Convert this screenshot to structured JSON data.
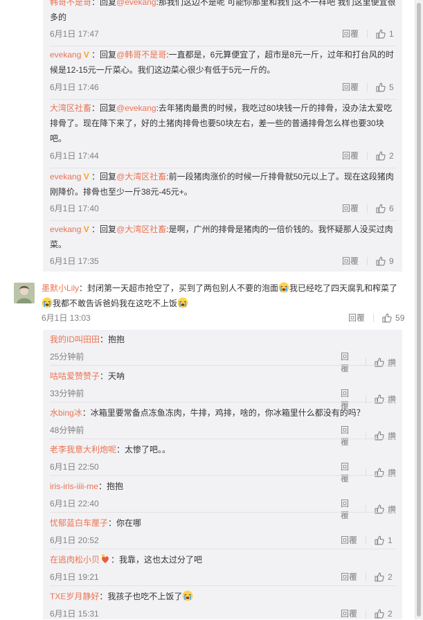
{
  "replies_top": [
    {
      "user": "韩哥不是哥",
      "verified": false,
      "reply_prefix": "：回复",
      "reply_to": "@evekang",
      "text": ":那我们这边不是呢  可能你那里和我们这不一样吧  我们这里便宜很多的",
      "time": "6月1日 17:47",
      "reply_label": "回覆",
      "likes": "1"
    },
    {
      "user": "evekang",
      "verified": true,
      "reply_prefix": "：回复",
      "reply_to": "@韩哥不是哥",
      "text": ":一直都是，6元算便宜了，超市是8元一斤，过年和打台风的时候是12-15元一斤菜心。我们这边菜心很少有低于5元一斤的。",
      "time": "6月1日 17:46",
      "reply_label": "回覆",
      "likes": "5"
    },
    {
      "user": "大湾区社畜",
      "verified": false,
      "reply_prefix": "：回复",
      "reply_to": "@evekang",
      "text": ":去年猪肉最贵的时候，我吃过80块钱一斤的排骨，没办法太爱吃排骨了。现在降下来了，好的土猪肉排骨也要50块左右，差一些的普通排骨怎么样也要30块吧。",
      "time": "6月1日 17:44",
      "reply_label": "回覆",
      "likes": "2"
    },
    {
      "user": "evekang",
      "verified": true,
      "reply_prefix": "：回复",
      "reply_to": "@大湾区社畜",
      "text": ":前一段猪肉涨价的时候一斤排骨就50元以上了。现在这段猪肉刚降价。排骨也至少一斤38元-45元+。",
      "time": "6月1日 17:40",
      "reply_label": "回覆",
      "likes": "6"
    },
    {
      "user": "evekang",
      "verified": true,
      "reply_prefix": "：回复",
      "reply_to": "@大湾区社畜",
      "text": ":是啊，广州的排骨是猪肉的一倍价钱的。我怀疑那人没买过肉菜。",
      "time": "6月1日 17:35",
      "reply_label": "回覆",
      "likes": "9"
    }
  ],
  "main_comment": {
    "user": "墨默小Lily",
    "text_a": "：封闭第一天超市抢空了，买到了两包别人不要的泡面",
    "text_b": "我已经吃了四天腐乳和榨菜了",
    "text_c": "我都不敢告诉爸妈我在这吃不上饭",
    "emoji": "crying-emoji",
    "time": "6月1日 13:03",
    "reply_label": "回覆",
    "likes": "59"
  },
  "replies_bottom": [
    {
      "user": "我的ID叫田田",
      "text": "：抱抱",
      "time": "25分钟前",
      "reply_label": "回覆",
      "likes": "讚"
    },
    {
      "user": "咕咕爱赞赞子",
      "text": "：天呐",
      "time": "33分钟前",
      "reply_label": "回覆",
      "likes": "讚"
    },
    {
      "user": "水bing冰",
      "text": "：冰箱里要常备点冻鱼冻肉，牛排，鸡排，啥的，你冰箱里什么都没有的吗？",
      "time": "48分钟前",
      "reply_label": "回覆",
      "likes": "讚"
    },
    {
      "user": "老李我意大利炮呢",
      "text": "：太惨了吧。。",
      "time": "6月1日 22:50",
      "reply_label": "回覆",
      "likes": "讚"
    },
    {
      "user": "iris-iris-iiii-me",
      "text": "：抱抱",
      "time": "6月1日 22:40",
      "reply_label": "回覆",
      "likes": "讚"
    },
    {
      "user": "忧郁蓝白车厘子",
      "text": "：你在哪",
      "time": "6月1日 20:52",
      "reply_label": "回覆",
      "likes": "1"
    },
    {
      "user": "在逃肉松小贝",
      "text": "：我靠，这也太过分了吧",
      "time": "6月1日 19:21",
      "reply_label": "回覆",
      "likes": "2"
    },
    {
      "user": "TXE岁月静好",
      "text": "：我孩子也吃不上饭了",
      "time": "6月1日 15:31",
      "reply_label": "回覆",
      "likes": "2"
    }
  ],
  "colors": {
    "username": "#eb7350",
    "reply_bg": "#f2f2f5",
    "meta": "#808080",
    "verified": "#f5a623"
  },
  "icons": [
    "thumbs-up-icon",
    "verified-v-icon",
    "crying-emoji",
    "avatar"
  ]
}
